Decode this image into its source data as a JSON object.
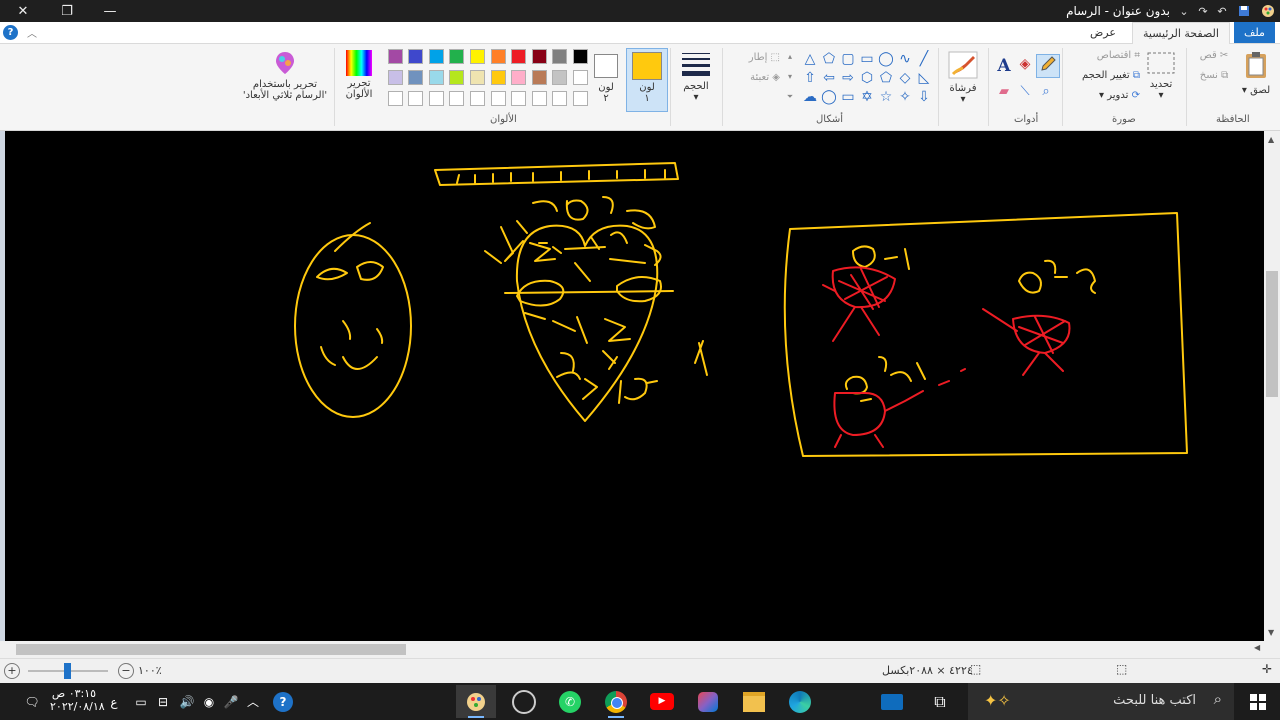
{
  "window": {
    "title": "بدون عنوان - الرسام"
  },
  "tabs": [
    {
      "label": "ملف"
    },
    {
      "label": "الصفحة الرئيسية"
    },
    {
      "label": "عرض"
    }
  ],
  "ribbon": {
    "clipboard": {
      "group": "الحافظة",
      "paste": "لصق",
      "cut": "قص",
      "copy": "نسخ"
    },
    "image": {
      "group": "صورة",
      "select": "تحديد",
      "crop": "اقتصاص",
      "resize": "تغيير الحجم",
      "rotate": "تدوير"
    },
    "tools": {
      "group": "أدوات"
    },
    "brushes": {
      "label": "فرشاة"
    },
    "shapes": {
      "group": "أشكال",
      "outline": "إطار",
      "fill": "تعبئة"
    },
    "size": {
      "label": "الحجم"
    },
    "color1": {
      "label_line1": "لون",
      "label_line2": "١",
      "value": "#ffc90e"
    },
    "color2": {
      "label_line1": "لون",
      "label_line2": "٢",
      "value": "#ffffff"
    },
    "colors": {
      "group": "الألوان"
    },
    "edit_colors": {
      "line1": "تحرير",
      "line2": "الألوان"
    },
    "paint3d": {
      "line1": "تحرير باستخدام",
      "line2": "'الرسام ثلاثي الأبعاد'"
    }
  },
  "palette": {
    "row1": [
      "#000000",
      "#7f7f7f",
      "#880015",
      "#ed1c24",
      "#ff7f27",
      "#fff200",
      "#22b14c",
      "#00a2e8",
      "#3f48cc",
      "#a349a4"
    ],
    "row2": [
      "#ffffff",
      "#c3c3c3",
      "#b97a57",
      "#ffaec9",
      "#ffc90e",
      "#efe4b0",
      "#b5e61d",
      "#99d9ea",
      "#7092be",
      "#c8bfe7"
    ],
    "row3": [
      "#ffffff",
      "#ffffff",
      "#ffffff",
      "#ffffff",
      "#ffffff",
      "#ffffff",
      "#ffffff",
      "#ffffff",
      "#ffffff",
      "#ffffff"
    ]
  },
  "canvas_drawing": {
    "background": "#000000",
    "stroke_primary": "#ffc90e",
    "stroke_secondary": "#ed1c24"
  },
  "status": {
    "dimensions": "٤٢٢٤ × ٢٠٨٨بكسل",
    "zoom": "١٠٠٪"
  },
  "taskbar": {
    "search_placeholder": "اكتب هنا للبحث",
    "time": "٠٣:١٥ ص",
    "date": "٢٠٢٢/٠٨/١٨",
    "lang": "ع"
  },
  "colors": {
    "accent": "#1e72c8",
    "taskbar": "#1c1c1c"
  }
}
